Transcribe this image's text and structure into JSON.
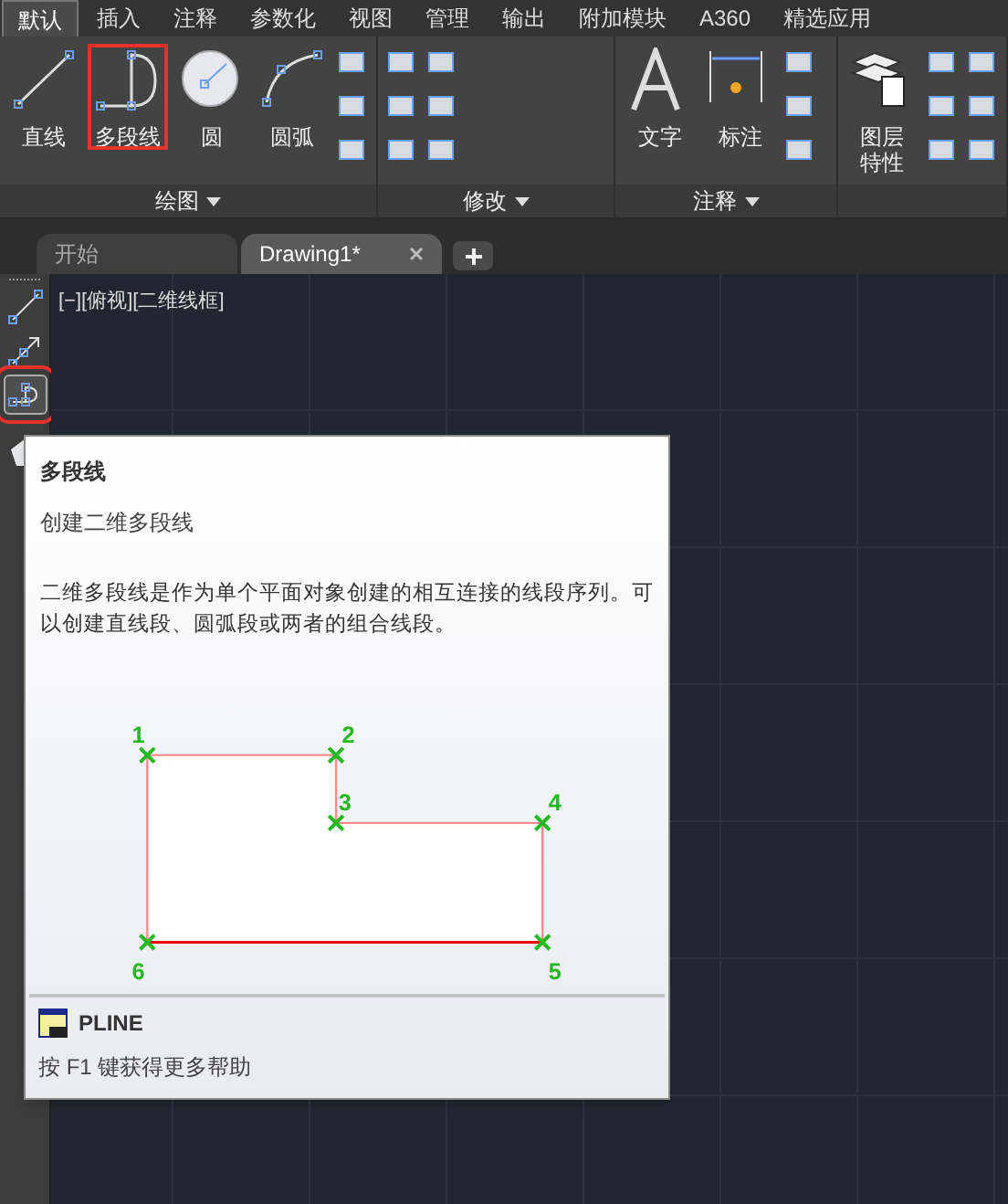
{
  "ribbon_tabs": [
    {
      "label": "默认",
      "selected": true
    },
    {
      "label": "插入",
      "selected": false
    },
    {
      "label": "注释",
      "selected": false
    },
    {
      "label": "参数化",
      "selected": false
    },
    {
      "label": "视图",
      "selected": false
    },
    {
      "label": "管理",
      "selected": false
    },
    {
      "label": "输出",
      "selected": false
    },
    {
      "label": "附加模块",
      "selected": false
    },
    {
      "label": "A360",
      "selected": false
    },
    {
      "label": "精选应用",
      "selected": false
    }
  ],
  "panels": [
    {
      "title": "绘图",
      "tools": [
        {
          "kind": "line",
          "label": "直线",
          "highlighted": false
        },
        {
          "kind": "polyline",
          "label": "多段线",
          "highlighted": true
        },
        {
          "kind": "circle",
          "label": "圆",
          "highlighted": false
        },
        {
          "kind": "arc",
          "label": "圆弧",
          "highlighted": false
        }
      ]
    },
    {
      "title": "修改"
    },
    {
      "title": "注释",
      "tools": [
        {
          "kind": "text",
          "label": "文字",
          "highlighted": false
        },
        {
          "kind": "dimension",
          "label": "标注",
          "highlighted": false
        }
      ]
    },
    {
      "tools": [
        {
          "kind": "layers",
          "label": "图层特性",
          "highlighted": false
        }
      ]
    }
  ],
  "file_tabs": [
    {
      "label": "开始",
      "selected": false
    },
    {
      "label": "Drawing1*",
      "selected": true
    }
  ],
  "viewport_label": "[−][俯视][二维线框]",
  "left_toolbar": [
    {
      "kind": "line",
      "highlighted": false
    },
    {
      "kind": "ray",
      "highlighted": false
    },
    {
      "kind": "polyline",
      "highlighted": true
    },
    {
      "kind": "polygon",
      "highlighted": false
    }
  ],
  "tooltip": {
    "title": "多段线",
    "subtitle": "创建二维多段线",
    "description": "二维多段线是作为单个平面对象创建的相互连接的线段序列。可以创建直线段、圆弧段或两者的组合线段。",
    "points": [
      "1",
      "2",
      "3",
      "4",
      "5",
      "6"
    ],
    "command": "PLINE",
    "help": "按 F1 键获得更多帮助"
  }
}
